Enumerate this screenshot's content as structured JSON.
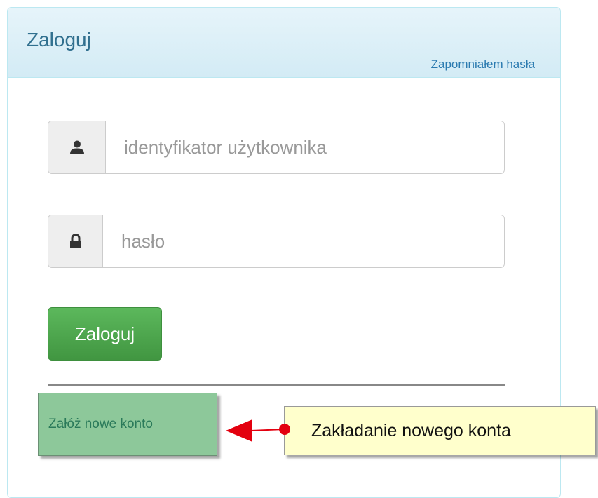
{
  "panel": {
    "title": "Zaloguj",
    "forgot_password_link": "Zapomniałem hasła"
  },
  "form": {
    "username_placeholder": "identyfikator użytkownika",
    "username_value": "",
    "username_icon": "user-icon",
    "password_placeholder": "hasło",
    "password_value": "",
    "password_icon": "lock-icon",
    "submit_label": "Zaloguj"
  },
  "register_link": "Załóż nowe konto",
  "annotation": {
    "text": "Zakładanie nowego konta",
    "color": "#e3000f"
  },
  "colors": {
    "panel_border": "#bce8f1",
    "heading_text": "#31708f",
    "button_green": "#5cb85c",
    "register_bg": "#8dc89a",
    "callout_bg": "#ffffcc"
  }
}
